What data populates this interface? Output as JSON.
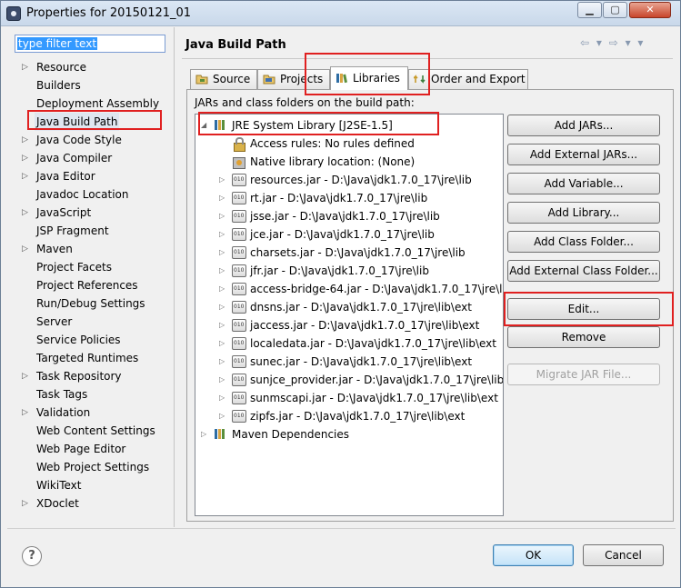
{
  "window": {
    "title": "Properties for 20150121_01",
    "controls": {
      "minimize": "▁",
      "maximize": "▢",
      "close": "✕"
    }
  },
  "filter": {
    "placeholder": "type filter text"
  },
  "nav": {
    "items": [
      {
        "label": "Resource",
        "expandable": true
      },
      {
        "label": "Builders",
        "expandable": false
      },
      {
        "label": "Deployment Assembly",
        "expandable": false
      },
      {
        "label": "Java Build Path",
        "expandable": false,
        "selected": true
      },
      {
        "label": "Java Code Style",
        "expandable": true
      },
      {
        "label": "Java Compiler",
        "expandable": true
      },
      {
        "label": "Java Editor",
        "expandable": true
      },
      {
        "label": "Javadoc Location",
        "expandable": false
      },
      {
        "label": "JavaScript",
        "expandable": true
      },
      {
        "label": "JSP Fragment",
        "expandable": false
      },
      {
        "label": "Maven",
        "expandable": true
      },
      {
        "label": "Project Facets",
        "expandable": false
      },
      {
        "label": "Project References",
        "expandable": false
      },
      {
        "label": "Run/Debug Settings",
        "expandable": false
      },
      {
        "label": "Server",
        "expandable": false
      },
      {
        "label": "Service Policies",
        "expandable": false
      },
      {
        "label": "Targeted Runtimes",
        "expandable": false
      },
      {
        "label": "Task Repository",
        "expandable": true
      },
      {
        "label": "Task Tags",
        "expandable": false
      },
      {
        "label": "Validation",
        "expandable": true
      },
      {
        "label": "Web Content Settings",
        "expandable": false
      },
      {
        "label": "Web Page Editor",
        "expandable": false
      },
      {
        "label": "Web Project Settings",
        "expandable": false
      },
      {
        "label": "WikiText",
        "expandable": false
      },
      {
        "label": "XDoclet",
        "expandable": true
      }
    ]
  },
  "page": {
    "title": "Java Build Path",
    "nav_arrows": "⇦ ▾ ⇨ ▾ ▾"
  },
  "tabs": [
    {
      "label": "Source",
      "icon": "source-folder-icon"
    },
    {
      "label": "Projects",
      "icon": "projects-icon"
    },
    {
      "label": "Libraries",
      "icon": "libraries-icon",
      "active": true
    },
    {
      "label": "Order and Export",
      "icon": "order-export-icon"
    }
  ],
  "libraries": {
    "panel_label": "JARs and class folders on the build path:",
    "tree": [
      {
        "text": "JRE System Library [J2SE-1.5]",
        "level": 0,
        "expander": "expanded",
        "icon": "library-icon"
      },
      {
        "text": "Access rules: No rules defined",
        "level": 1,
        "expander": "none",
        "icon": "access-rules-icon"
      },
      {
        "text": "Native library location: (None)",
        "level": 1,
        "expander": "none",
        "icon": "native-library-icon"
      },
      {
        "text": "resources.jar - D:\\Java\\jdk1.7.0_17\\jre\\lib",
        "level": 1,
        "expander": "collapsed",
        "icon": "jar-icon"
      },
      {
        "text": "rt.jar - D:\\Java\\jdk1.7.0_17\\jre\\lib",
        "level": 1,
        "expander": "collapsed",
        "icon": "jar-icon"
      },
      {
        "text": "jsse.jar - D:\\Java\\jdk1.7.0_17\\jre\\lib",
        "level": 1,
        "expander": "collapsed",
        "icon": "jar-icon"
      },
      {
        "text": "jce.jar - D:\\Java\\jdk1.7.0_17\\jre\\lib",
        "level": 1,
        "expander": "collapsed",
        "icon": "jar-icon"
      },
      {
        "text": "charsets.jar - D:\\Java\\jdk1.7.0_17\\jre\\lib",
        "level": 1,
        "expander": "collapsed",
        "icon": "jar-icon"
      },
      {
        "text": "jfr.jar - D:\\Java\\jdk1.7.0_17\\jre\\lib",
        "level": 1,
        "expander": "collapsed",
        "icon": "jar-icon"
      },
      {
        "text": "access-bridge-64.jar - D:\\Java\\jdk1.7.0_17\\jre\\lib\\",
        "level": 1,
        "expander": "collapsed",
        "icon": "jar-icon"
      },
      {
        "text": "dnsns.jar - D:\\Java\\jdk1.7.0_17\\jre\\lib\\ext",
        "level": 1,
        "expander": "collapsed",
        "icon": "jar-icon"
      },
      {
        "text": "jaccess.jar - D:\\Java\\jdk1.7.0_17\\jre\\lib\\ext",
        "level": 1,
        "expander": "collapsed",
        "icon": "jar-icon"
      },
      {
        "text": "localedata.jar - D:\\Java\\jdk1.7.0_17\\jre\\lib\\ext",
        "level": 1,
        "expander": "collapsed",
        "icon": "jar-icon"
      },
      {
        "text": "sunec.jar - D:\\Java\\jdk1.7.0_17\\jre\\lib\\ext",
        "level": 1,
        "expander": "collapsed",
        "icon": "jar-icon"
      },
      {
        "text": "sunjce_provider.jar - D:\\Java\\jdk1.7.0_17\\jre\\lib",
        "level": 1,
        "expander": "collapsed",
        "icon": "jar-icon"
      },
      {
        "text": "sunmscapi.jar - D:\\Java\\jdk1.7.0_17\\jre\\lib\\ext",
        "level": 1,
        "expander": "collapsed",
        "icon": "jar-icon"
      },
      {
        "text": "zipfs.jar - D:\\Java\\jdk1.7.0_17\\jre\\lib\\ext",
        "level": 1,
        "expander": "collapsed",
        "icon": "jar-icon"
      },
      {
        "text": "Maven Dependencies",
        "level": 0,
        "expander": "collapsed",
        "icon": "library-icon"
      }
    ],
    "buttons": {
      "add_jars": "Add JARs...",
      "add_external_jars": "Add External JARs...",
      "add_variable": "Add Variable...",
      "add_library": "Add Library...",
      "add_class_folder": "Add Class Folder...",
      "add_external_class_folder": "Add External Class Folder...",
      "edit": "Edit...",
      "remove": "Remove",
      "migrate_jar": "Migrate JAR File..."
    }
  },
  "dialog": {
    "help": "?",
    "ok": "OK",
    "cancel": "Cancel"
  },
  "colors": {
    "highlight_box": "#e02020",
    "selection": "#3399ff"
  }
}
